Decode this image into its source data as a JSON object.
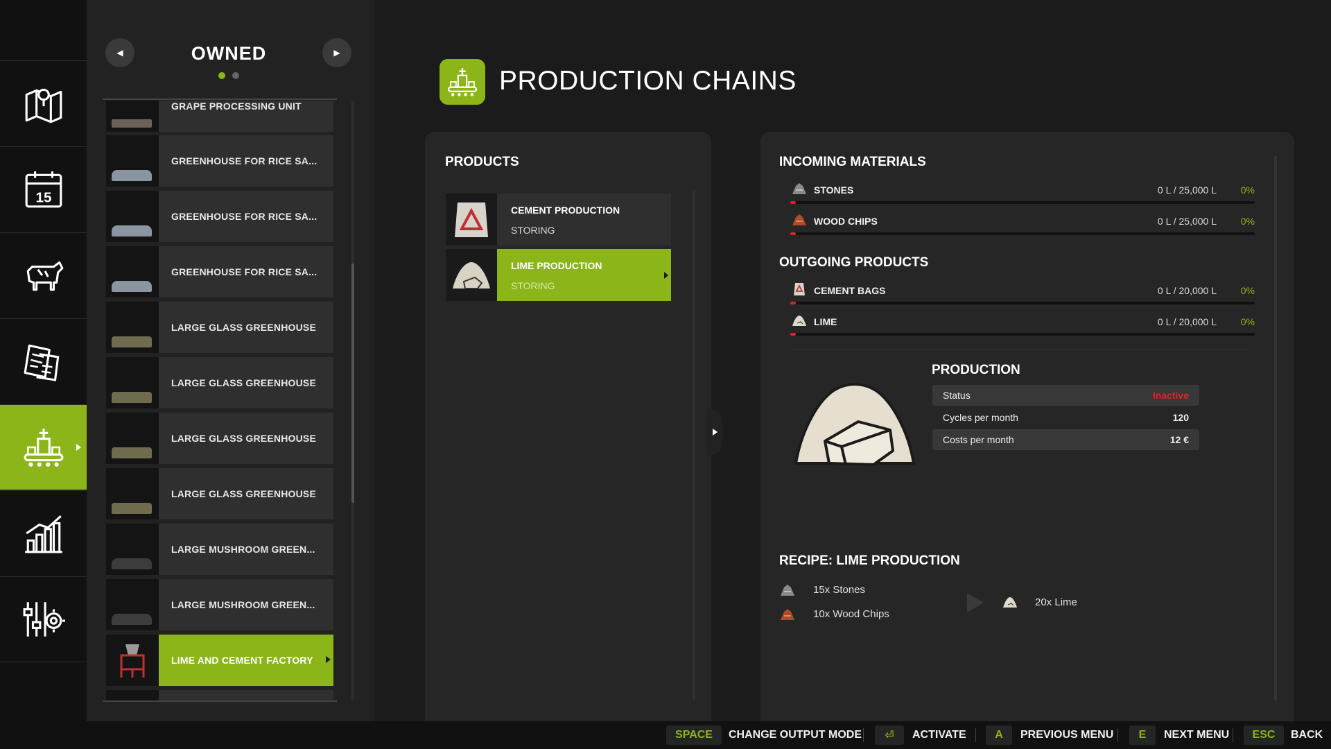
{
  "sidebar": {
    "items": [
      {
        "icon": "map-icon"
      },
      {
        "icon": "calendar-icon",
        "text": "15"
      },
      {
        "icon": "animals-icon"
      },
      {
        "icon": "contracts-icon"
      },
      {
        "icon": "production-icon",
        "active": true
      },
      {
        "icon": "statistics-icon"
      },
      {
        "icon": "settings-icon"
      }
    ]
  },
  "list": {
    "title": "OWNED",
    "items": [
      {
        "label": "GRAPE PROCESSING UNIT"
      },
      {
        "label": "GREENHOUSE FOR RICE SA..."
      },
      {
        "label": "GREENHOUSE FOR RICE SA..."
      },
      {
        "label": "GREENHOUSE FOR RICE SA..."
      },
      {
        "label": "LARGE GLASS GREENHOUSE"
      },
      {
        "label": "LARGE GLASS GREENHOUSE"
      },
      {
        "label": "LARGE GLASS GREENHOUSE"
      },
      {
        "label": "LARGE GLASS GREENHOUSE"
      },
      {
        "label": "LARGE MUSHROOM GREEN..."
      },
      {
        "label": "LARGE MUSHROOM GREEN..."
      },
      {
        "label": "LIME AND CEMENT FACTORY",
        "active": true
      }
    ]
  },
  "header": {
    "title": "PRODUCTION CHAINS"
  },
  "products": {
    "title": "PRODUCTS",
    "items": [
      {
        "name": "CEMENT PRODUCTION",
        "state": "STORING"
      },
      {
        "name": "LIME PRODUCTION",
        "state": "STORING",
        "active": true
      }
    ]
  },
  "incoming": {
    "title": "INCOMING MATERIALS",
    "items": [
      {
        "name": "STONES",
        "value": "0 L / 25,000 L",
        "pct": "0%",
        "fill": 0
      },
      {
        "name": "WOOD CHIPS",
        "value": "0 L / 25,000 L",
        "pct": "0%",
        "fill": 0
      }
    ]
  },
  "outgoing": {
    "title": "OUTGOING PRODUCTS",
    "items": [
      {
        "name": "CEMENT BAGS",
        "value": "0 L / 20,000 L",
        "pct": "0%",
        "fill": 0
      },
      {
        "name": "LIME",
        "value": "0 L / 20,000 L",
        "pct": "0%",
        "fill": 0
      }
    ]
  },
  "production": {
    "title": "PRODUCTION",
    "rows": [
      {
        "label": "Status",
        "value": "Inactive"
      },
      {
        "label": "Cycles per month",
        "value": "120"
      },
      {
        "label": "Costs per month",
        "value": "12 €"
      }
    ]
  },
  "recipe": {
    "title": "RECIPE: LIME PRODUCTION",
    "inputs": [
      "15x Stones",
      "10x Wood Chips"
    ],
    "output": "20x Lime"
  },
  "footer": {
    "actions": [
      {
        "key": "SPACE",
        "label": "CHANGE OUTPUT MODE"
      },
      {
        "key": "⏎",
        "label": "ACTIVATE"
      },
      {
        "key": "A",
        "label": "PREVIOUS MENU"
      },
      {
        "key": "E",
        "label": "NEXT MENU"
      },
      {
        "key": "ESC",
        "label": "BACK"
      }
    ]
  },
  "colors": {
    "accent": "#8cb51a",
    "inactive": "#e0242a",
    "bar_fill": "#d8232a"
  }
}
